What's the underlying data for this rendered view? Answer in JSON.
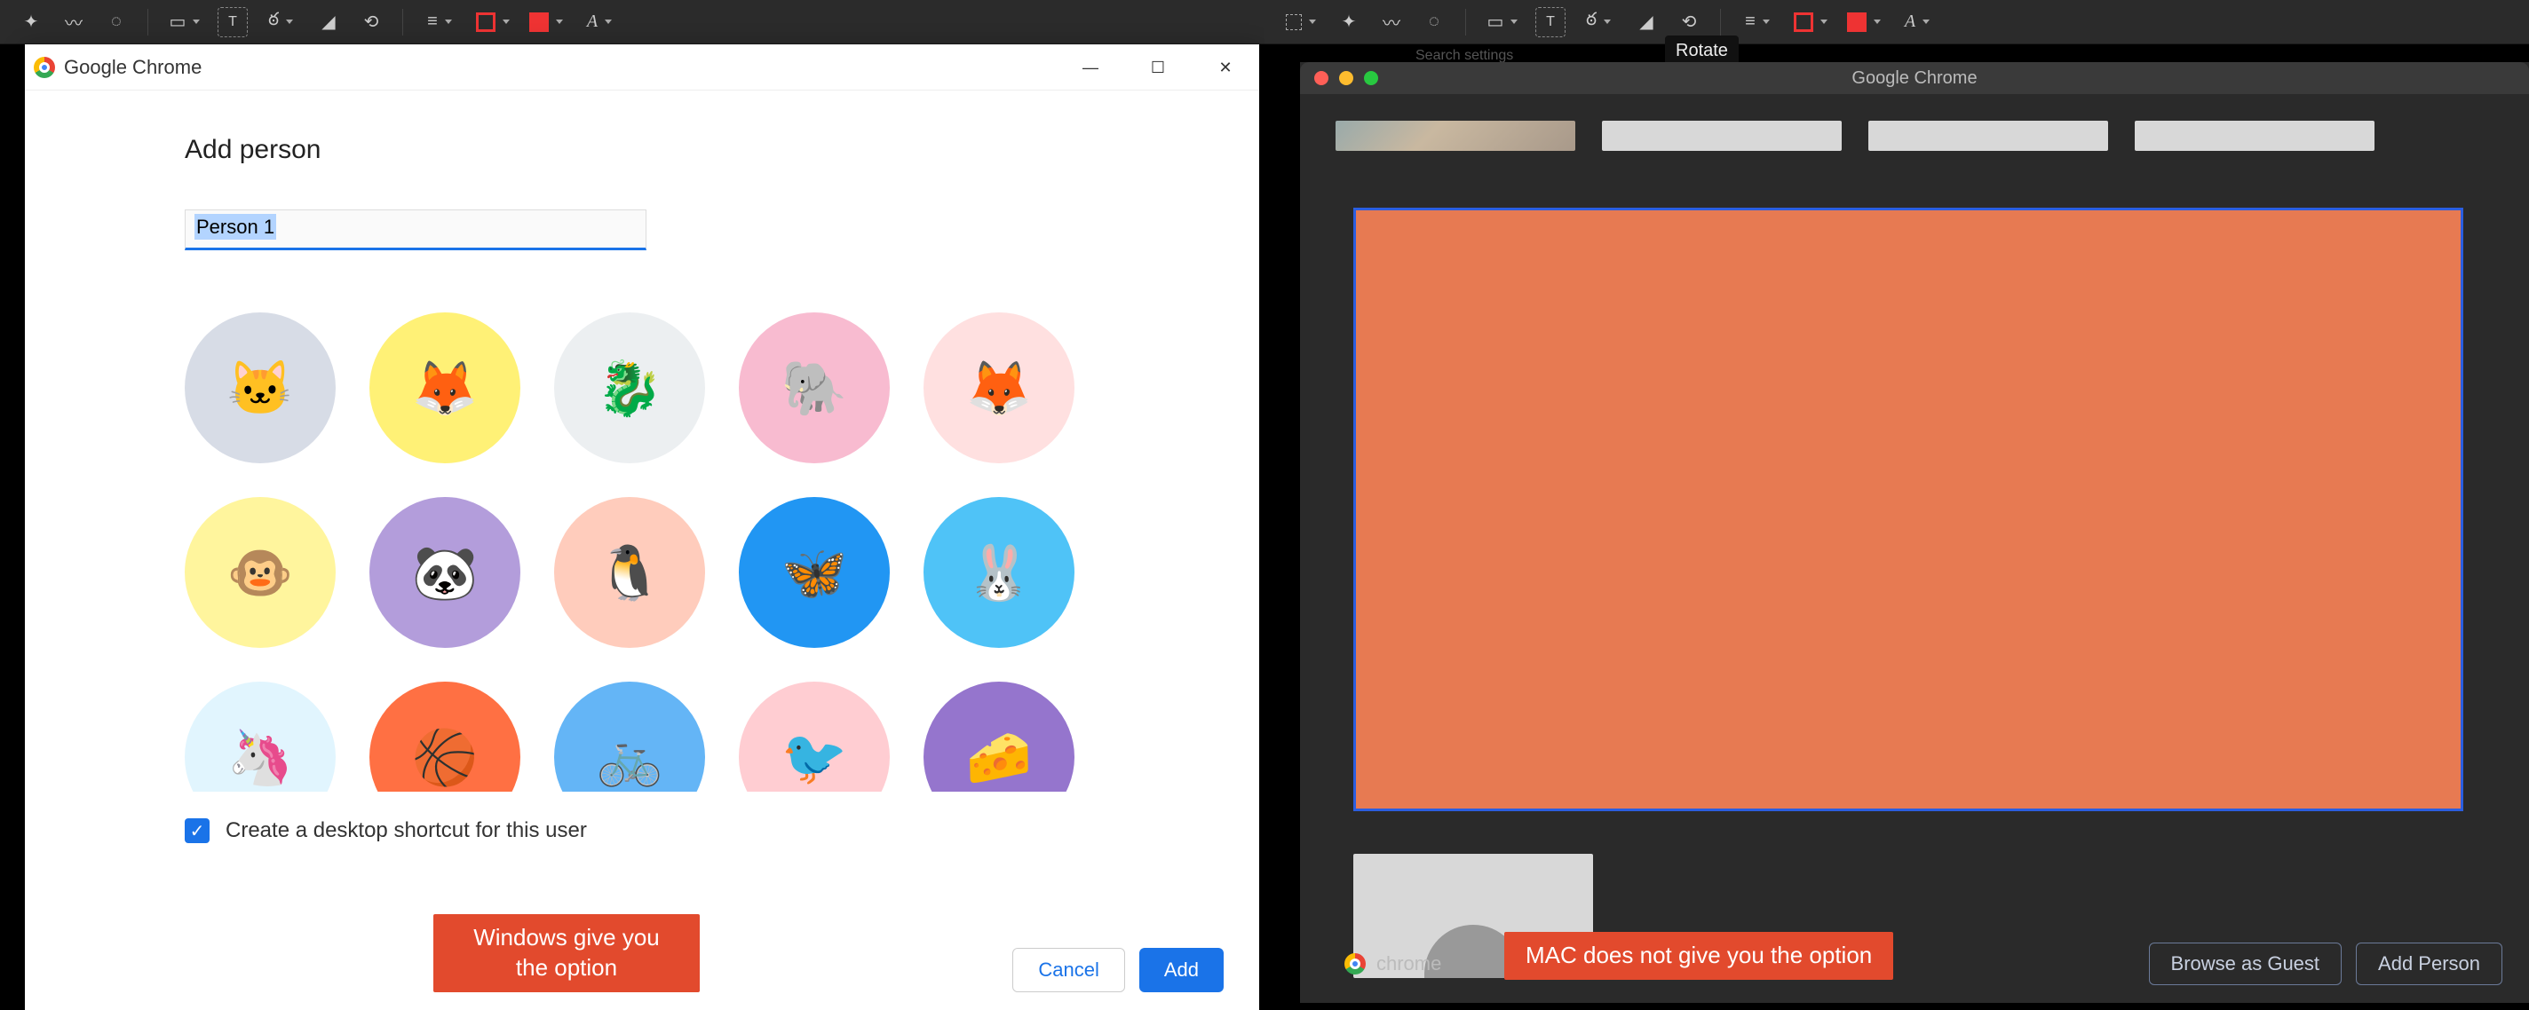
{
  "left": {
    "toolbar_icons": [
      "sparkle",
      "brush",
      "eraser",
      "shape",
      "text",
      "signature",
      "mask",
      "rotate",
      "lines",
      "outline-color",
      "fill-color",
      "font"
    ],
    "dialog": {
      "title": "Google Chrome",
      "heading": "Add person",
      "name_value": "Person 1",
      "avatars": [
        {
          "bg": "#d7dce6",
          "emoji": "🐱",
          "name": "avatar-cat-grey"
        },
        {
          "bg": "#fff176",
          "emoji": "🦊",
          "name": "avatar-fox-yellow"
        },
        {
          "bg": "#eceff1",
          "emoji": "🐉",
          "name": "avatar-dragon-grey"
        },
        {
          "bg": "#f8bbd0",
          "emoji": "🐘",
          "name": "avatar-elephant-pink"
        },
        {
          "bg": "#ffe0e0",
          "emoji": "🦊",
          "name": "avatar-fox-pink"
        },
        {
          "bg": "#fff59d",
          "emoji": "🐵",
          "name": "avatar-monkey-yellow"
        },
        {
          "bg": "#b39ddb",
          "emoji": "🐼",
          "name": "avatar-panda-purple"
        },
        {
          "bg": "#ffccbc",
          "emoji": "🐧",
          "name": "avatar-penguin-peach"
        },
        {
          "bg": "#2196f3",
          "emoji": "🦋",
          "name": "avatar-butterfly-blue"
        },
        {
          "bg": "#4fc3f7",
          "emoji": "🐰",
          "name": "avatar-rabbit-cyan"
        },
        {
          "bg": "#e1f5fe",
          "emoji": "🦄",
          "name": "avatar-unicorn-blue"
        },
        {
          "bg": "#ff7043",
          "emoji": "🏀",
          "name": "avatar-basketball"
        },
        {
          "bg": "#64b5f6",
          "emoji": "🚲",
          "name": "avatar-bicycle"
        },
        {
          "bg": "#ffcdd2",
          "emoji": "🐦",
          "name": "avatar-bird-pink"
        },
        {
          "bg": "#9575cd",
          "emoji": "🧀",
          "name": "avatar-cheese-purple"
        }
      ],
      "checkbox_label": "Create a desktop shortcut for this user",
      "checkbox_checked": true,
      "cancel": "Cancel",
      "add": "Add",
      "annotation": "Windows give you\nthe option"
    }
  },
  "right": {
    "toolbar_icons": [
      "select",
      "sparkle",
      "brush",
      "eraser",
      "shape",
      "text",
      "signature",
      "mask",
      "rotate",
      "lines",
      "outline-color",
      "fill-color",
      "font"
    ],
    "tooltip": "Rotate",
    "search_hint": "Search settings",
    "mac_window": {
      "title": "Google Chrome",
      "footer_brand": "chrome",
      "browse_guest": "Browse as Guest",
      "add_person": "Add Person",
      "annotation": "MAC does not give you the option"
    }
  },
  "colors": {
    "accent_blue": "#1a73e8",
    "annotation_bg": "#e24a2d",
    "orange_fill": "#e77a52",
    "rect_border": "#2b5ee0"
  }
}
